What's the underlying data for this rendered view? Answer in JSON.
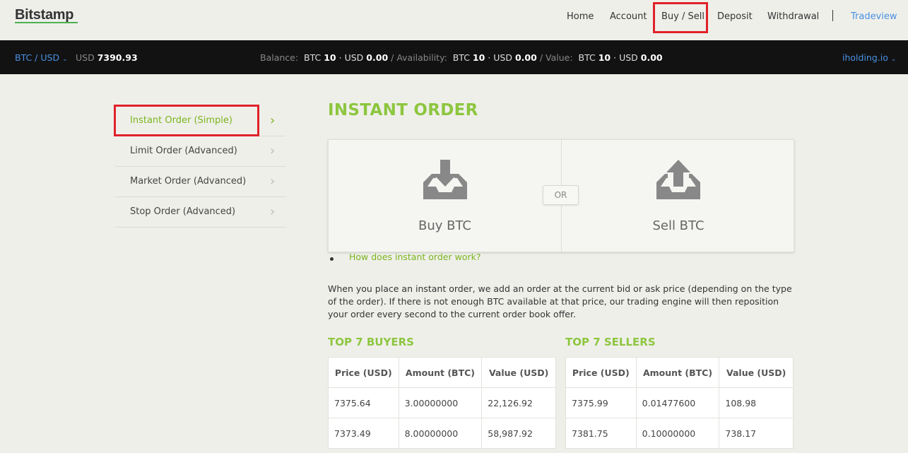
{
  "header": {
    "logo": "Bitstamp",
    "nav": {
      "home": "Home",
      "account": "Account",
      "buy_sell": "Buy / Sell",
      "deposit": "Deposit",
      "withdrawal": "Withdrawal",
      "tradeview": "Tradeview"
    }
  },
  "topbar": {
    "pair": "BTC / USD",
    "price_currency": "USD",
    "price": "7390.93",
    "balance_label": "Balance:",
    "availability_label": "Availability:",
    "value_label": "Value:",
    "btc": "BTC",
    "usd": "USD",
    "balance_btc": "10",
    "balance_usd": "0.00",
    "availability_btc": "10",
    "availability_usd": "0.00",
    "value_btc": "10",
    "value_usd": "0.00",
    "dot": "·",
    "slash": "/",
    "account": "iholding.io"
  },
  "sidebar": {
    "items": [
      {
        "label": "Instant Order (Simple)"
      },
      {
        "label": "Limit Order (Advanced)"
      },
      {
        "label": "Market Order (Advanced)"
      },
      {
        "label": "Stop Order (Advanced)"
      }
    ]
  },
  "main": {
    "title": "INSTANT ORDER",
    "buy_label": "Buy BTC",
    "sell_label": "Sell BTC",
    "or_label": "OR",
    "how_link": "How does instant order work?",
    "description": "When you place an instant order, we add an order at the current bid or ask price (depending on the type of the order). If there is not enough BTC available at that price, our trading engine will then reposition your order every second to the current order book offer."
  },
  "buyers": {
    "title": "TOP 7 BUYERS",
    "headers": [
      "Price (USD)",
      "Amount (BTC)",
      "Value (USD)"
    ],
    "rows": [
      [
        "7375.64",
        "3.00000000",
        "22,126.92"
      ],
      [
        "7373.49",
        "8.00000000",
        "58,987.92"
      ]
    ]
  },
  "sellers": {
    "title": "TOP 7 SELLERS",
    "headers": [
      "Price (USD)",
      "Amount (BTC)",
      "Value (USD)"
    ],
    "rows": [
      [
        "7375.99",
        "0.01477600",
        "108.98"
      ],
      [
        "7381.75",
        "0.10000000",
        "738.17"
      ]
    ]
  },
  "colors": {
    "accent_green": "#8dc63f",
    "link_blue": "#4a90e2",
    "highlight_red": "#e0222a",
    "topbar_bg": "#121212"
  }
}
